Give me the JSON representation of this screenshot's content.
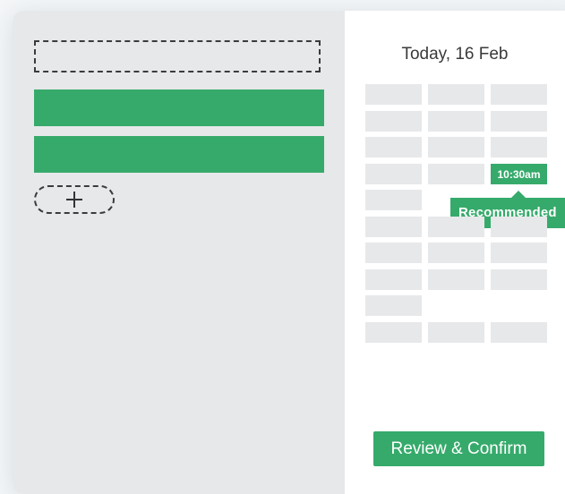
{
  "calendar": {
    "date_label": "Today, 16 Feb",
    "slots": [
      [
        true,
        true,
        true
      ],
      [
        true,
        true,
        true
      ],
      [
        true,
        true,
        true
      ],
      [
        true,
        true,
        "selected"
      ],
      [
        true,
        false,
        false
      ],
      [
        true,
        true,
        true
      ],
      [
        true,
        true,
        true
      ],
      [
        true,
        true,
        true
      ],
      [
        true,
        false,
        false
      ],
      [
        true,
        true,
        true
      ]
    ],
    "selected_time": "10:30am",
    "tooltip": "Recommended"
  },
  "actions": {
    "review_label": "Review & Confirm",
    "add_icon": "plus-icon"
  },
  "colors": {
    "accent": "#36aa6b",
    "panel": "#e7e8ea",
    "text": "#3a3a3a"
  }
}
